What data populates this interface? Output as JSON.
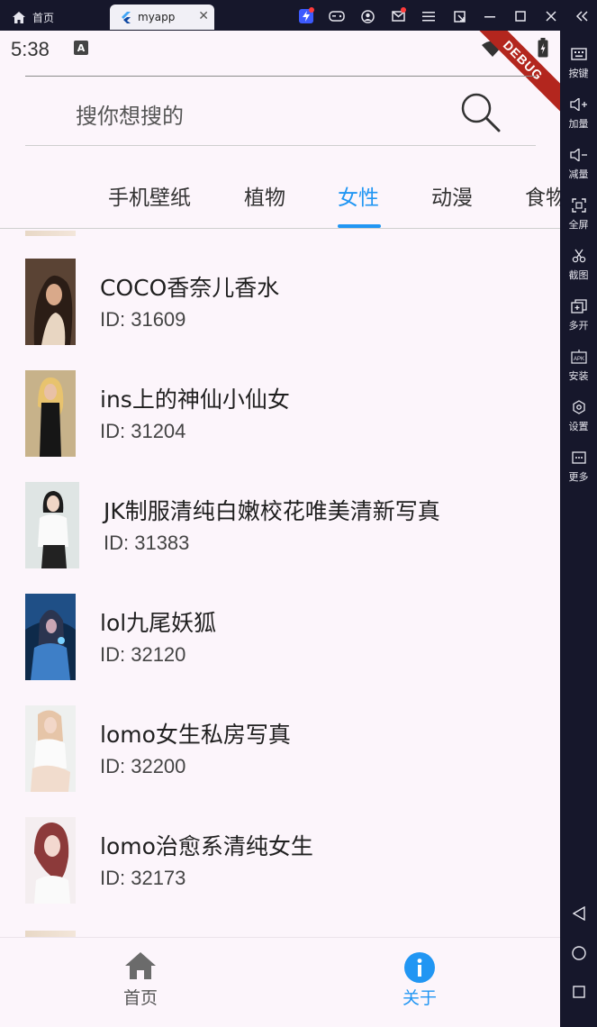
{
  "emulator": {
    "home_tab": "首页",
    "app_tab": "myapp",
    "sidebar": [
      "按键",
      "加量",
      "减量",
      "全屏",
      "截图",
      "多开",
      "安装",
      "设置",
      "更多"
    ]
  },
  "status_bar": {
    "time": "5:38",
    "debug_banner": "DEBUG"
  },
  "search": {
    "placeholder": "搜你想搜的"
  },
  "tabs": [
    "手机壁纸",
    "植物",
    "女性",
    "动漫",
    "食物"
  ],
  "active_tab": "女性",
  "items": [
    {
      "title": "COCO香奈儿香水",
      "id": "ID: 31609"
    },
    {
      "title": "ins上的神仙小仙女",
      "id": "ID: 31204"
    },
    {
      "title": "JK制服清纯白嫩校花唯美清新写真",
      "id": "ID: 31383"
    },
    {
      "title": "lol九尾妖狐",
      "id": "ID: 32120"
    },
    {
      "title": "lomo女生私房写真",
      "id": "ID: 32200"
    },
    {
      "title": "lomo治愈系清纯女生",
      "id": "ID: 32173"
    }
  ],
  "bottom_nav": {
    "home": "首页",
    "about": "关于"
  },
  "colors": {
    "accent": "#2196f3",
    "background": "#fcf5fb",
    "debug": "#b3261e"
  }
}
